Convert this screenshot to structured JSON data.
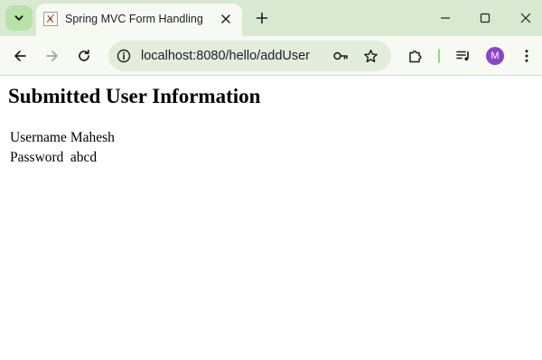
{
  "browser": {
    "tab": {
      "title": "Spring MVC Form Handling"
    },
    "address_bar": {
      "url": "localhost:8080/hello/addUser"
    },
    "profile_initial": "M"
  },
  "page": {
    "heading": "Submitted User Information",
    "rows": [
      {
        "label": "Username",
        "value": "Mahesh"
      },
      {
        "label": "Password",
        "value": "abcd"
      }
    ]
  }
}
